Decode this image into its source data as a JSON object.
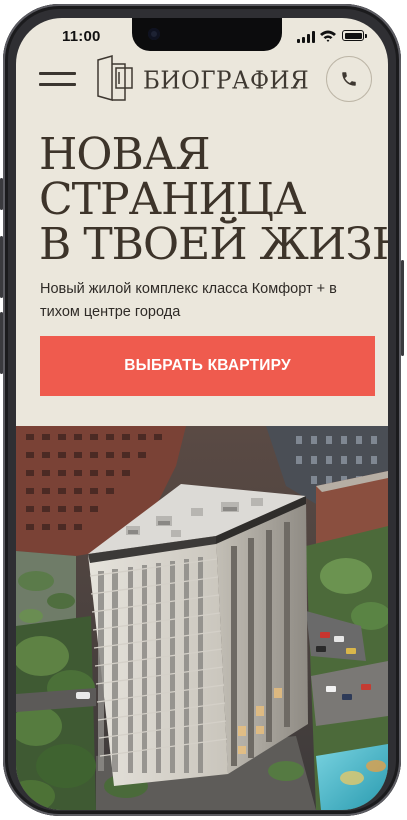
{
  "status_bar": {
    "time": "11:00"
  },
  "header": {
    "menu_icon": "hamburger-menu-icon",
    "brand_name": "БИОГРАФИЯ",
    "call_icon": "phone-icon"
  },
  "hero": {
    "headline_lines": [
      "НОВАЯ",
      "СТРАНИЦА",
      "В ТВОЕЙ ЖИЗНИ"
    ],
    "subtitle": "Новый жилой комплекс класса Комфорт + в тихом центре города",
    "cta_label": "ВЫБРАТЬ КВАРТИРУ",
    "image": "aerial-view-residential-tower"
  },
  "colors": {
    "background": "#ebe7dc",
    "text": "#3d342a",
    "accent": "#ef5b4e"
  }
}
